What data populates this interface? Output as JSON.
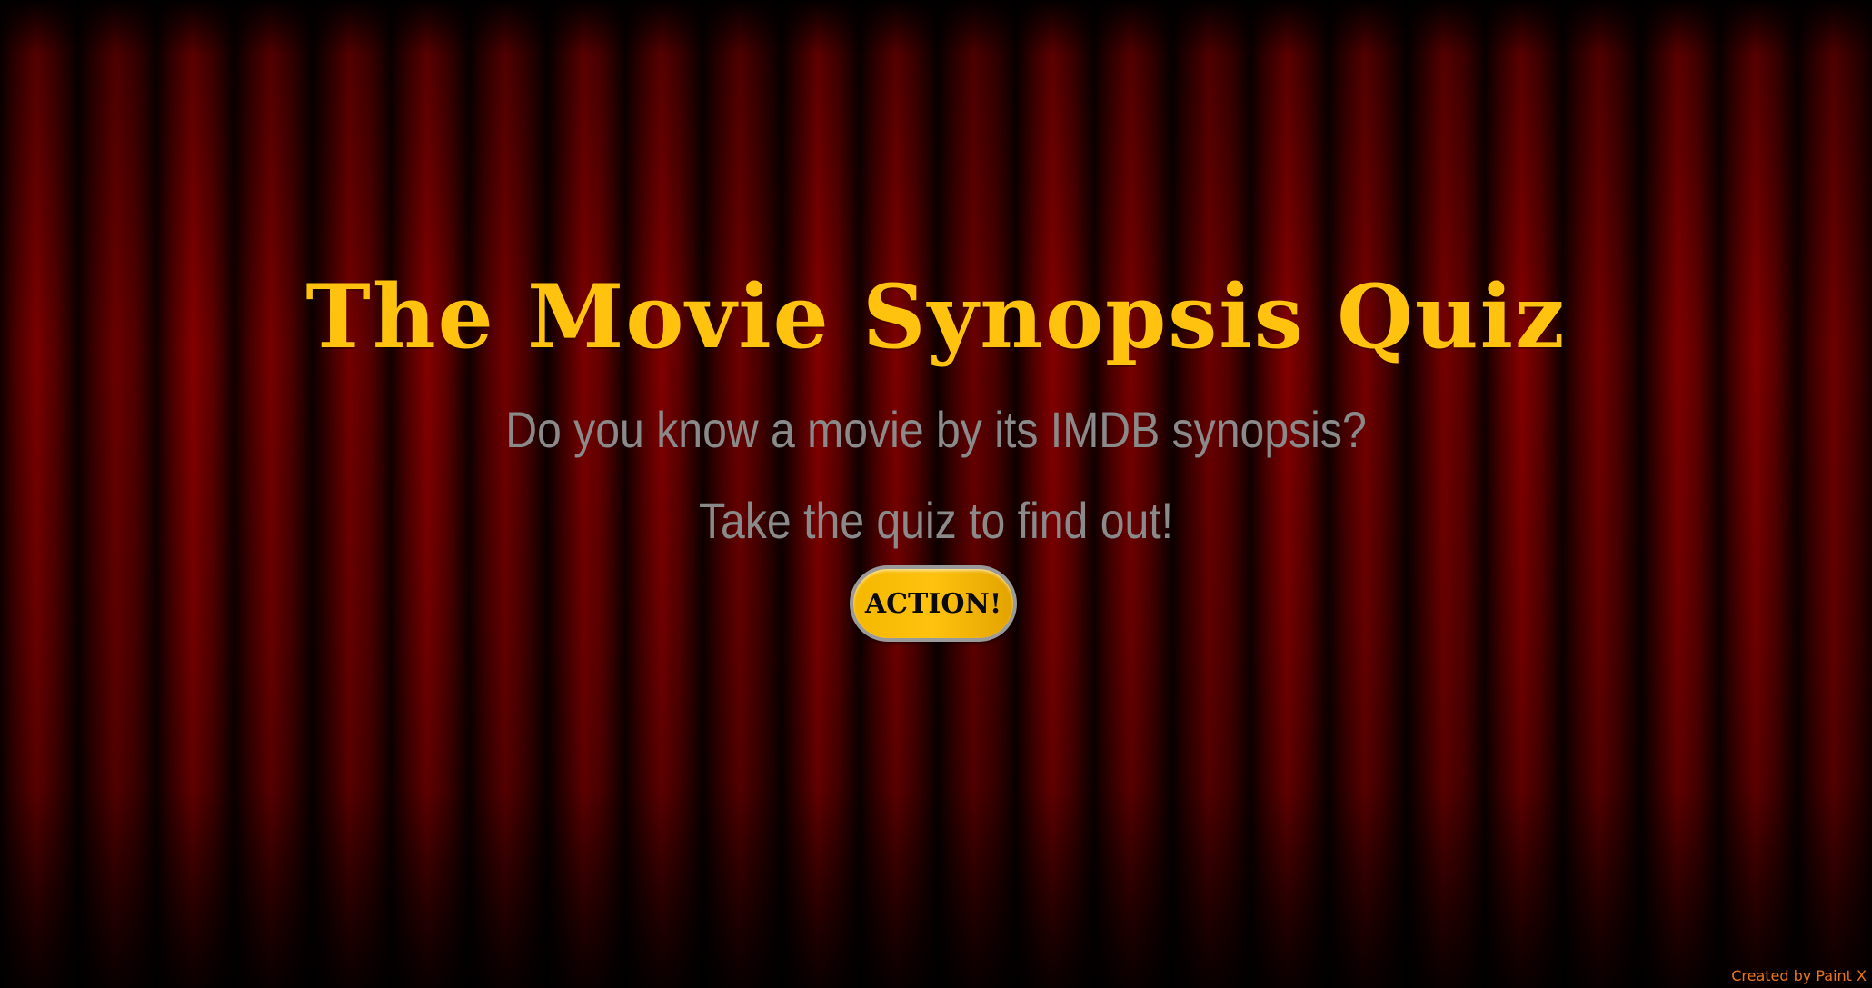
{
  "page": {
    "title": "The Movie Synopsis Quiz",
    "subtitle_line1": "Do you know a movie by its IMDB synopsis?",
    "subtitle_line2": "Take the quiz to find out!",
    "start_button_label": "ACTION!",
    "credit": "Created by Paint X"
  },
  "colors": {
    "title": "#ffc20e",
    "subtitle": "#8a8a8a",
    "button_fill": "#ffc20e",
    "button_border": "#9a9a9a",
    "credit": "#e8761a",
    "curtain": "#7a0000"
  },
  "background": {
    "type": "red-theater-curtain"
  }
}
